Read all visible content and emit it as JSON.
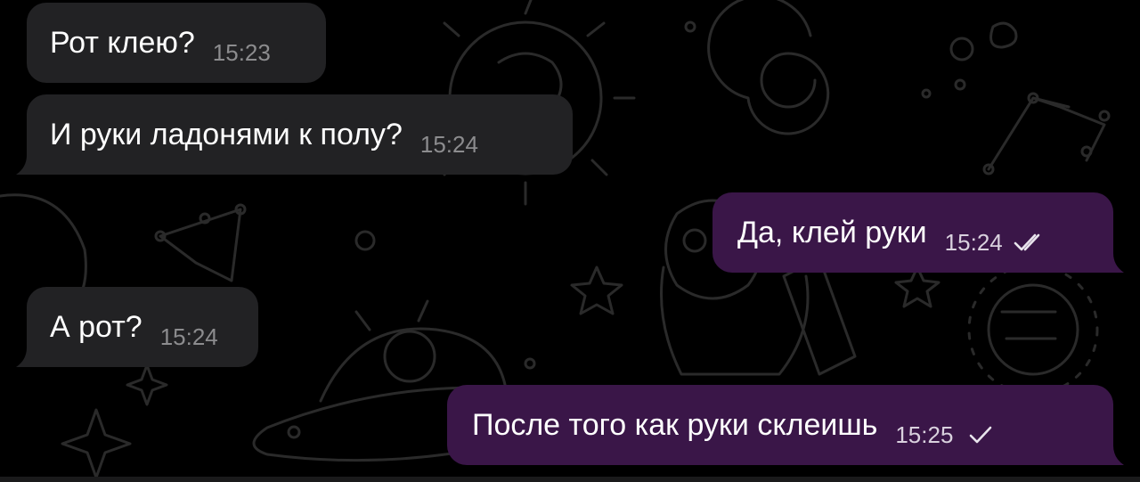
{
  "messages": [
    {
      "direction": "incoming",
      "text": "Рот клею?",
      "time": "15:23"
    },
    {
      "direction": "incoming",
      "text": "И руки ладонями к полу?",
      "time": "15:24"
    },
    {
      "direction": "outgoing",
      "text": "Да, клей руки",
      "time": "15:24",
      "status": "read",
      "status_icon": "double-check-icon"
    },
    {
      "direction": "incoming",
      "text": "А рот?",
      "time": "15:24"
    },
    {
      "direction": "outgoing",
      "text": "После того как руки склеишь",
      "time": "15:25",
      "status": "sent",
      "status_icon": "single-check-icon"
    }
  ],
  "colors": {
    "background": "#000000",
    "incoming_bubble": "#222224",
    "outgoing_bubble": "#3a1648",
    "text": "#ffffff",
    "incoming_time": "#8c8c8e",
    "outgoing_time": "#d9d1de",
    "wallpaper_line": "#2a2a2a"
  }
}
